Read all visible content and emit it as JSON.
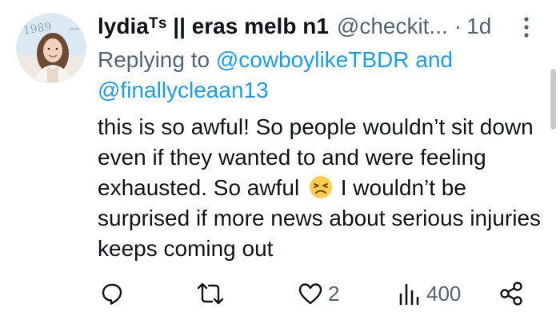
{
  "tweet": {
    "author": {
      "display_name": "lydiaᵀˢ || eras melb n1",
      "handle": "@checkit...",
      "avatar_text": "1989"
    },
    "time": "1d",
    "separator": "·",
    "reply": {
      "prefix": "Replying to ",
      "mention_1": "@cowboylikeTBDR",
      "joiner": " and",
      "mention_2": "@finallycleaan13"
    },
    "text": {
      "before_emoji": "this is so awful! So people wouldn’t sit down even if they wanted to and were feeling exhausted. So awful",
      "after_emoji": "I wouldn’t be surprised if more news about serious injuries keeps coming out"
    },
    "emoji": "persevering-face",
    "actions": {
      "reply_count": "",
      "retweet_count": "",
      "like_count": "2",
      "views_count": "400"
    }
  },
  "colors": {
    "text": "#0f1419",
    "secondary": "#536471",
    "accent": "#1d9bf0"
  },
  "icons": [
    "more-icon",
    "reply-icon",
    "retweet-icon",
    "like-icon",
    "views-icon",
    "share-icon"
  ]
}
